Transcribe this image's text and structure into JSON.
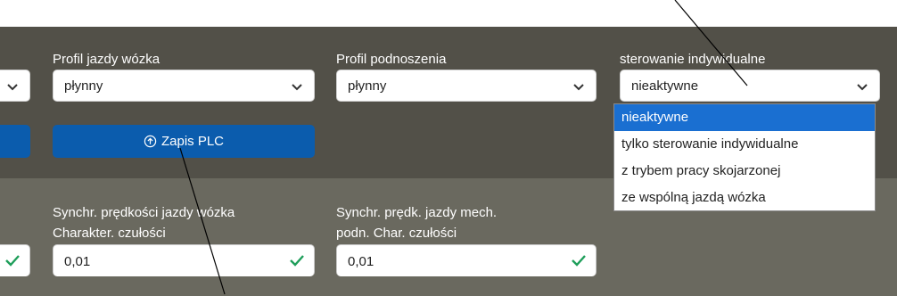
{
  "fields": {
    "profil_jazdy": {
      "label": "Profil jazdy wózka",
      "value": "płynny"
    },
    "profil_podnoszenia": {
      "label": "Profil podnoszenia",
      "value": "płynny"
    },
    "sterowanie": {
      "label": "sterowanie indywidualne",
      "value": "nieaktywne",
      "options": [
        "nieaktywne",
        "tylko sterowanie indywidualne",
        "z trybem pracy skojarzonej",
        "ze wspólną jazdą wózka"
      ]
    }
  },
  "buttons": {
    "zapis_plc": "Zapis PLC"
  },
  "synch": {
    "jazdy_wozka": {
      "label_line1": "Synchr. prędkości jazdy wózka",
      "label_line2": "Charakter. czułości",
      "value": "0,01"
    },
    "jazdy_mech": {
      "label_line1": "Synchr. prędk. jazdy mech.",
      "label_line2": "podn. Char. czułości",
      "value": "0,01"
    }
  },
  "colors": {
    "primary": "#0b5cad",
    "panel_dark": "#525048",
    "panel_mid": "#6a695f",
    "valid": "#1e9e5a",
    "highlight": "#1a6fd1"
  },
  "icons": {
    "chevron": "chevron-down-icon",
    "upload": "upload-circle-icon",
    "check": "checkmark-icon"
  }
}
